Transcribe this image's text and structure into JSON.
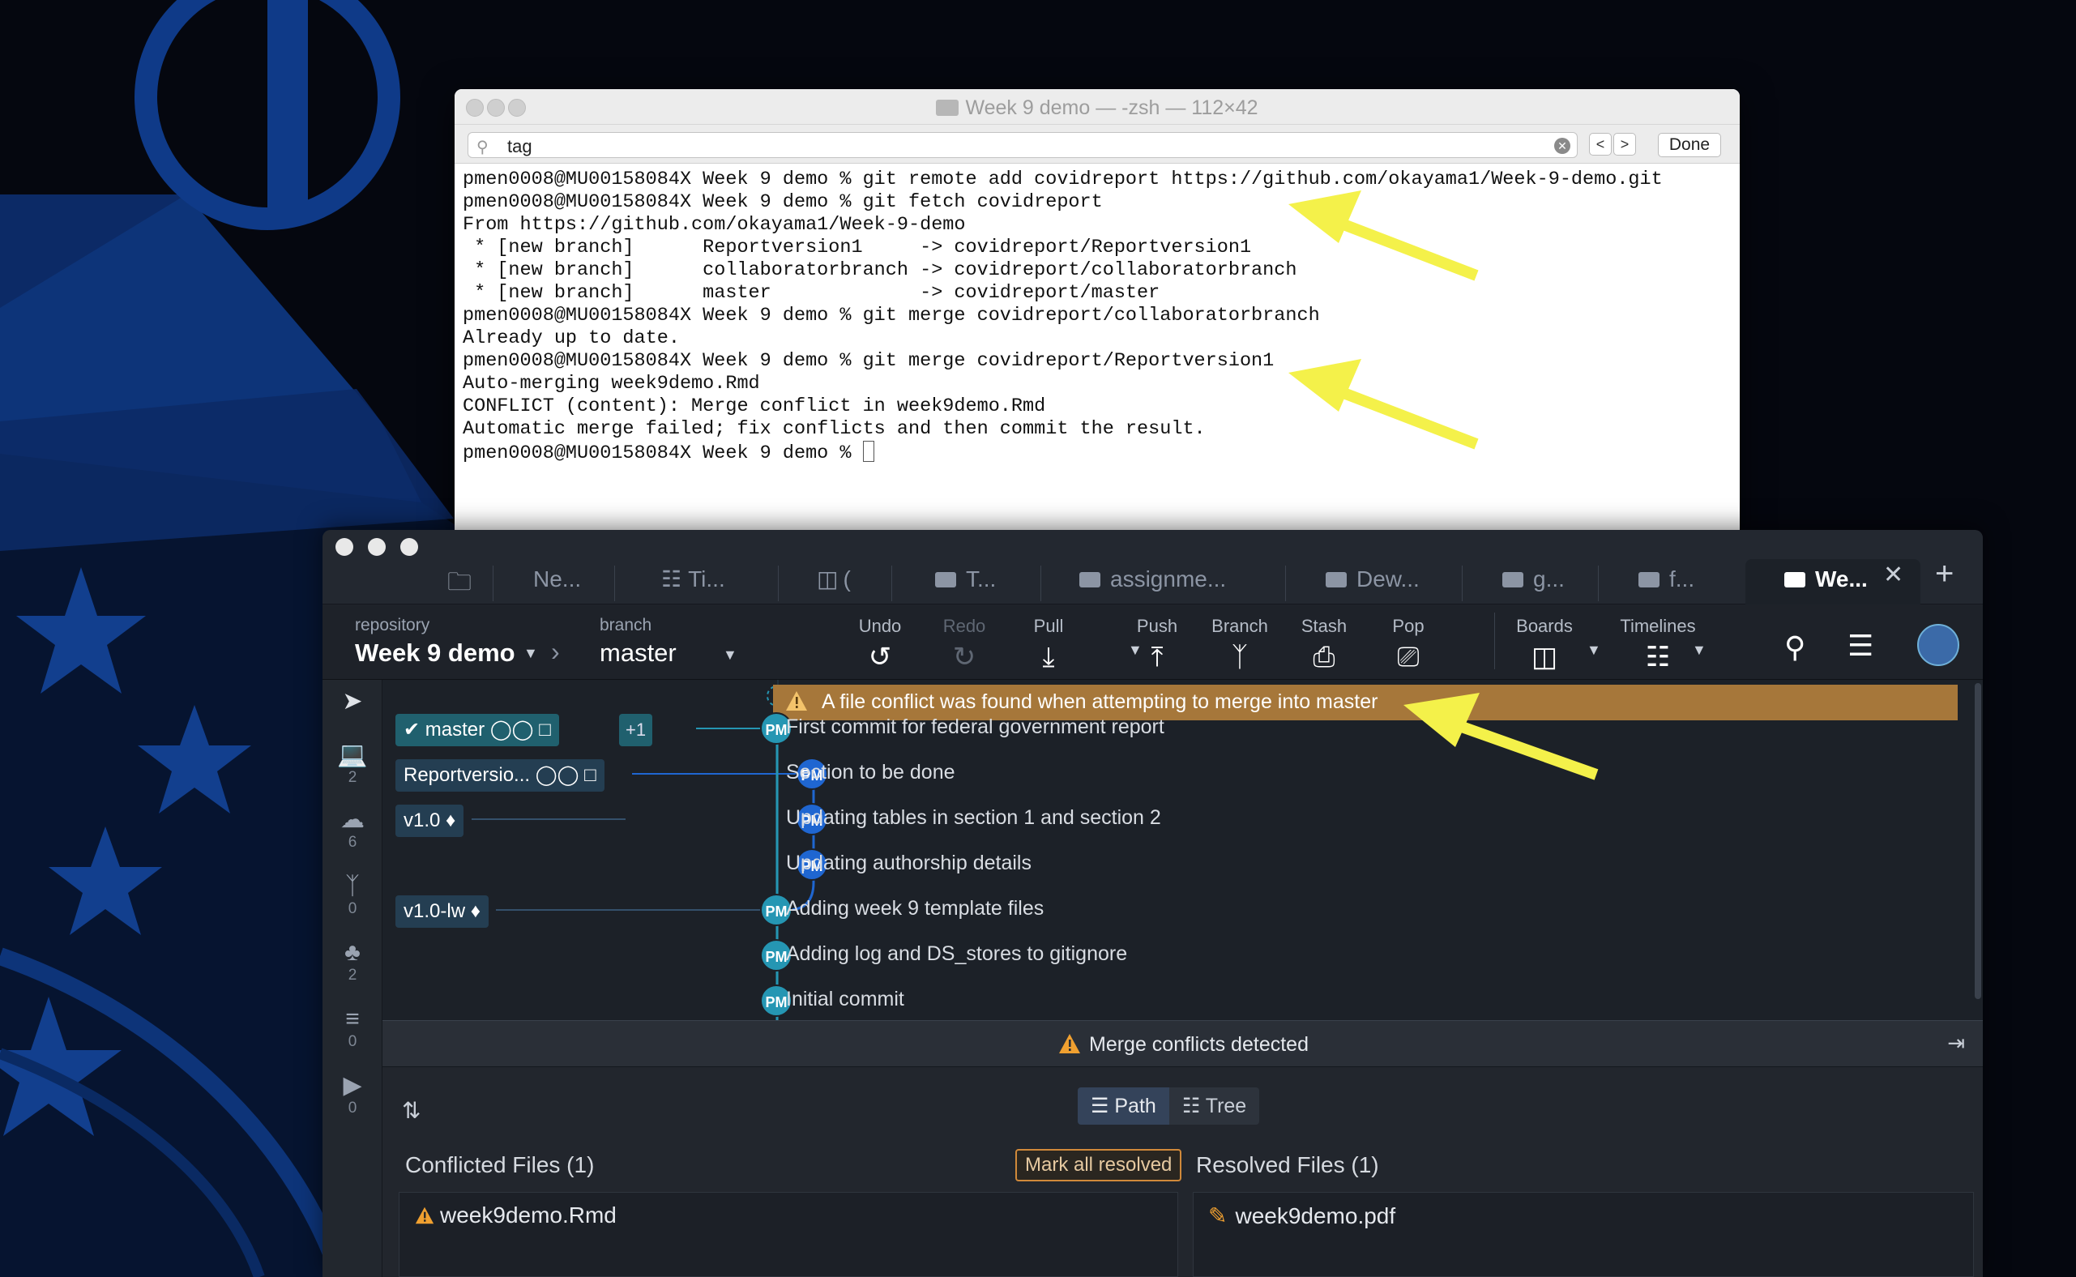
{
  "terminal": {
    "title": "Week 9 demo — -zsh — 112×42",
    "find": {
      "value": "tag",
      "done_label": "Done",
      "prev_label": "<",
      "next_label": ">"
    },
    "lines": [
      "pmen0008@MU00158084X Week 9 demo % git remote add covidreport https://github.com/okayama1/Week-9-demo.git",
      "pmen0008@MU00158084X Week 9 demo % git fetch covidreport",
      "From https://github.com/okayama1/Week-9-demo",
      " * [new branch]      Reportversion1     -> covidreport/Reportversion1",
      " * [new branch]      collaboratorbranch -> covidreport/collaboratorbranch",
      " * [new branch]      master             -> covidreport/master",
      "pmen0008@MU00158084X Week 9 demo % git merge covidreport/collaboratorbranch",
      "Already up to date.",
      "pmen0008@MU00158084X Week 9 demo % git merge covidreport/Reportversion1",
      "Auto-merging week9demo.Rmd",
      "CONFLICT (content): Merge conflict in week9demo.Rmd",
      "Automatic merge failed; fix conflicts and then commit the result.",
      "pmen0008@MU00158084X Week 9 demo % "
    ]
  },
  "gitkraken": {
    "tabs": [
      "Ne...",
      "Ti...",
      "(",
      "T...",
      "assignme...",
      "Dew...",
      "g...",
      "f...",
      "We..."
    ],
    "toolbar": {
      "repository_label": "repository",
      "repository_name": "Week 9 demo",
      "branch_label": "branch",
      "branch_name": "master",
      "actions": {
        "undo": "Undo",
        "redo": "Redo",
        "pull": "Pull",
        "push": "Push",
        "branch": "Branch",
        "stash": "Stash",
        "pop": "Pop",
        "boards": "Boards",
        "timelines": "Timelines"
      }
    },
    "sidebar": {
      "local_count": "2",
      "remote_count": "6",
      "pr_count": "0",
      "tags_count": "2",
      "stashes_count": "0",
      "actions_count": "0"
    },
    "graph": {
      "conflict_message": "A file conflict was found when attempting to merge into master",
      "commits": [
        {
          "message": "First commit for federal government report",
          "author": "PM"
        },
        {
          "message": "Section to be done",
          "author": "PM"
        },
        {
          "message": "Updating tables in section 1 and section 2",
          "author": "PM"
        },
        {
          "message": "Updating authorship details",
          "author": "PM"
        },
        {
          "message": "Adding week 9 template files",
          "author": "PM"
        },
        {
          "message": "Adding log and DS_stores to gitignore",
          "author": "PM"
        },
        {
          "message": "Initial commit",
          "author": "PM"
        }
      ],
      "refs": {
        "master": "master",
        "master_extra": "+1",
        "reportversion": "Reportversio...",
        "tag1": "v1.0",
        "tag2": "v1.0-lw"
      }
    },
    "merge_panel": {
      "header": "Merge conflicts detected",
      "view_path": "Path",
      "view_tree": "Tree",
      "conflicted_title": "Conflicted Files (1)",
      "mark_all_resolved": "Mark all resolved",
      "resolved_title": "Resolved Files (1)",
      "conflicted_files": [
        "week9demo.Rmd"
      ],
      "resolved_files": [
        "week9demo.pdf"
      ]
    }
  },
  "colors": {
    "conflict_highlight": "#a6773a",
    "arrow": "#f4f14a",
    "branch_teal": "#2596b3",
    "branch_blue": "#1f66d1"
  }
}
